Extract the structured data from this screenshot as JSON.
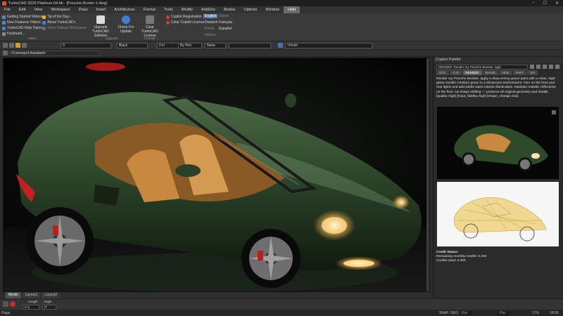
{
  "window": {
    "title": "TurboCAD 2026 Platinum 64-bit - [Porsche-Boxter-1.dwg]"
  },
  "menu": [
    "File",
    "Edit",
    "View",
    "Workspace",
    "Draw",
    "Insert",
    "Architecture",
    "Format",
    "Tools",
    "Modify",
    "AddOns",
    "Modes",
    "Options",
    "Window",
    "Help"
  ],
  "menu_active": "Help",
  "ribbon": {
    "getting_started": "Getting Started Videos",
    "new_features": "New Features Videos",
    "help_topics": "TurboCAD Help Topics",
    "keyboard": "Keyboard...",
    "tip_of_day": "Tip of the Day...",
    "about": "About TurboCAD+",
    "show_startup": "Show Startup Workspace",
    "upgrade": "Upgrade TurboCAD Editions",
    "check_update": "Check For Update",
    "clear_license": "Clear TurboCAD License",
    "copilot_registration": "Copilot Registration",
    "clear_copilot": "Clear Copilot License",
    "lang_english": "English",
    "lang_deutsch": "Deutsch",
    "lang_francais": "Français",
    "lang_polski": "Polski",
    "lang_espanol": "Español",
    "lang_dansk": "Dansk",
    "lang_italiano": "Italiano",
    "group_videos": "Video",
    "group_license": "License",
    "group_upgrade": "Upgrade"
  },
  "toolbar": {
    "layer": "0",
    "color": "Black",
    "width": "0 in",
    "pen": "By Pen",
    "pattern": "None",
    "find_placeholder": "<Find>",
    "command_assistant": "<Command Assistant>"
  },
  "layout_tabs": [
    "Model",
    "Layout1",
    "Layout2"
  ],
  "inspector": {
    "length_label": "Length",
    "angle_label": "Angle",
    "length_value": "0 in",
    "angle_value": "0°"
  },
  "status": {
    "left": "Flags",
    "snap": "SNAP",
    "geo": "GEO",
    "x": "0 in",
    "y": "0 in",
    "zoom": "17%",
    "time": "18:09"
  },
  "copilot": {
    "title": "Copilot Palette",
    "header": "RENDER: Render my Porsche Boxster, appl",
    "tabs": [
      "DOC",
      "CAD",
      "RENDER",
      "IMAGE",
      "VIDE",
      "PART",
      "API"
    ],
    "active_tab": "RENDER",
    "prompt": "Render my Porsche Boxster, apply a deep-emmy-green paint with a clean, high-gloss metallic medium green in a showroom environment. Turn on the front and rear lights and add subtle warm interior illumination. Maintain realistic reflections on the floor. No shape shifting — preserve all original geometry and details. [quality=high] [input_fidelity=high] [shape_change=low]",
    "credit_title": "Credit Status:",
    "credit_remaining": "Remaining monthly credits: 6.345",
    "credit_used": "Credits used: 0.300"
  },
  "colors": {
    "accent": "#5a7bb0",
    "car_green": "#2f4a2c",
    "interior": "#c8883e",
    "brake": "#b82020"
  }
}
